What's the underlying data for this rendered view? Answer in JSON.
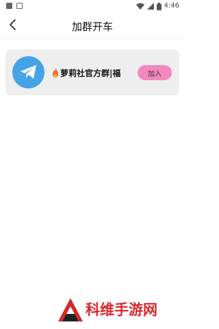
{
  "status_bar": {
    "time": "4:46",
    "icons": [
      "image-icon",
      "a-icon",
      "wifi-icon",
      "signal-icon",
      "battery-icon"
    ]
  },
  "app_bar": {
    "title": "加群开车",
    "back_icon": "chevron-left-icon"
  },
  "groups": [
    {
      "icon": "telegram-icon",
      "badge_icon": "fire-icon",
      "name": "萝莉社官方群|福",
      "join_label": "加入"
    }
  ],
  "watermark": {
    "text": "科维手游网",
    "logo": "triangle-logo"
  },
  "colors": {
    "avatar": "#45a4e6",
    "join_button": "#f487bc",
    "card": "#eeeeee",
    "watermark": "#d9262b"
  }
}
